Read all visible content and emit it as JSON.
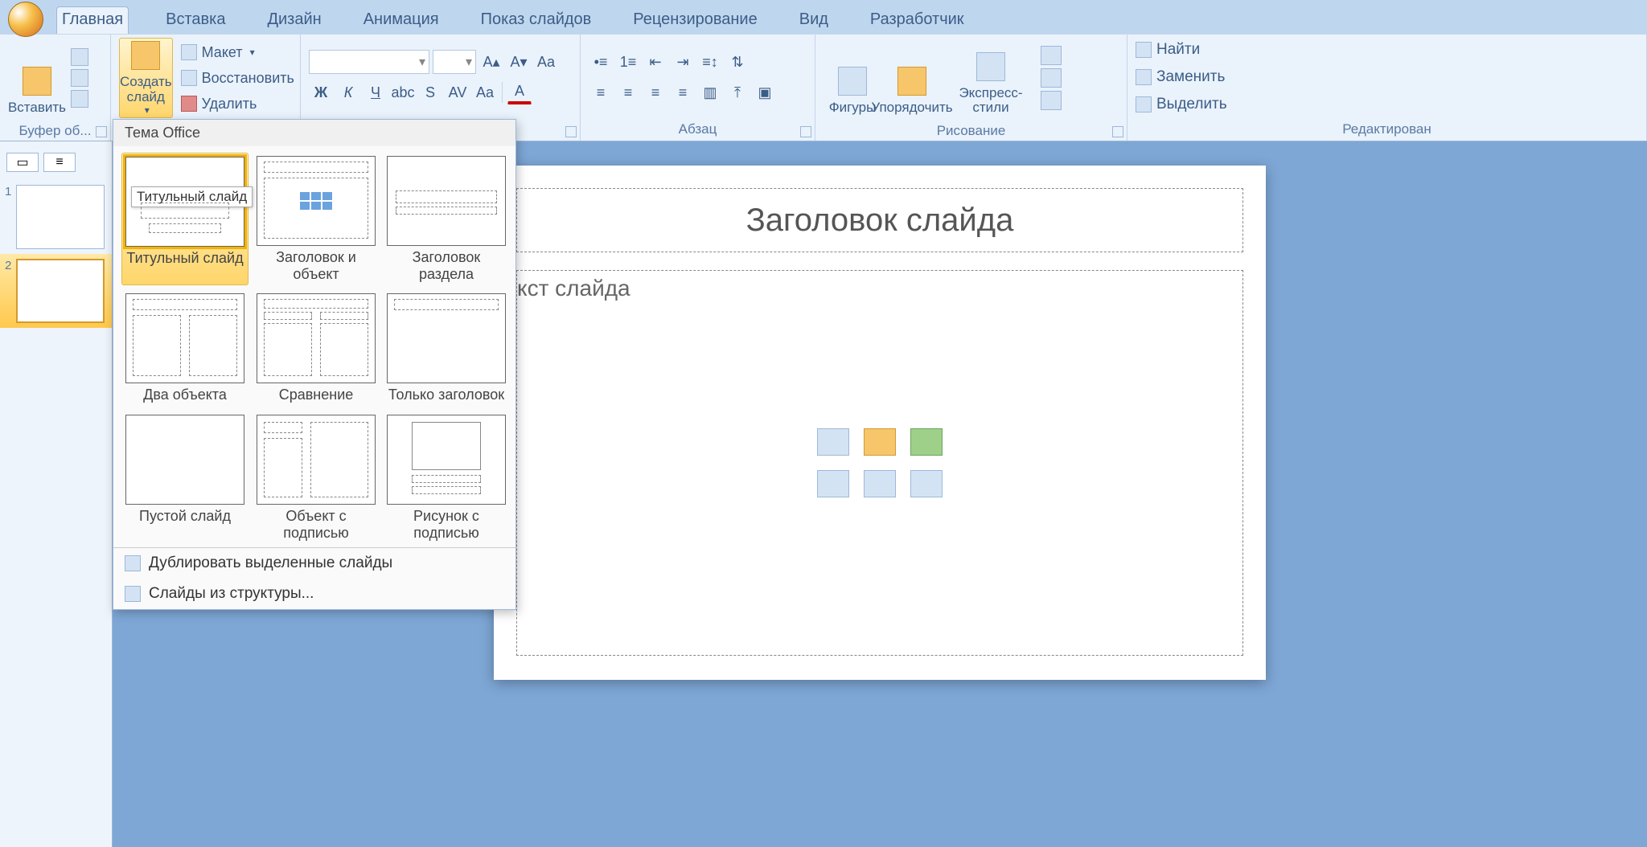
{
  "tabs": {
    "home": "Главная",
    "insert": "Вставка",
    "design": "Дизайн",
    "animation": "Анимация",
    "slideshow": "Показ слайдов",
    "review": "Рецензирование",
    "view": "Вид",
    "developer": "Разработчик"
  },
  "ribbon": {
    "clipboard": {
      "paste": "Вставить",
      "group": "Буфер об..."
    },
    "slides": {
      "new_slide": "Создать слайд",
      "layout": "Макет",
      "reset": "Восстановить",
      "delete": "Удалить"
    },
    "paragraph_group": "Абзац",
    "drawing": {
      "shapes": "Фигуры",
      "arrange": "Упорядочить",
      "styles": "Экспресс-стили",
      "group": "Рисование"
    },
    "editing": {
      "find": "Найти",
      "replace": "Заменить",
      "select": "Выделить",
      "group": "Редактирован"
    }
  },
  "gallery": {
    "section": "Тема Office",
    "tooltip": "Титульный слайд",
    "layouts": [
      "Титульный слайд",
      "Заголовок и объект",
      "Заголовок раздела",
      "Два объекта",
      "Сравнение",
      "Только заголовок",
      "Пустой слайд",
      "Объект с подписью",
      "Рисунок с подписью"
    ],
    "footer": {
      "duplicate": "Дублировать выделенные слайды",
      "from_outline": "Слайды из структуры..."
    }
  },
  "panel": {
    "n1": "1",
    "n2": "2"
  },
  "slide": {
    "title_placeholder": "Заголовок слайда",
    "body_placeholder_frag": "кст слайда"
  }
}
